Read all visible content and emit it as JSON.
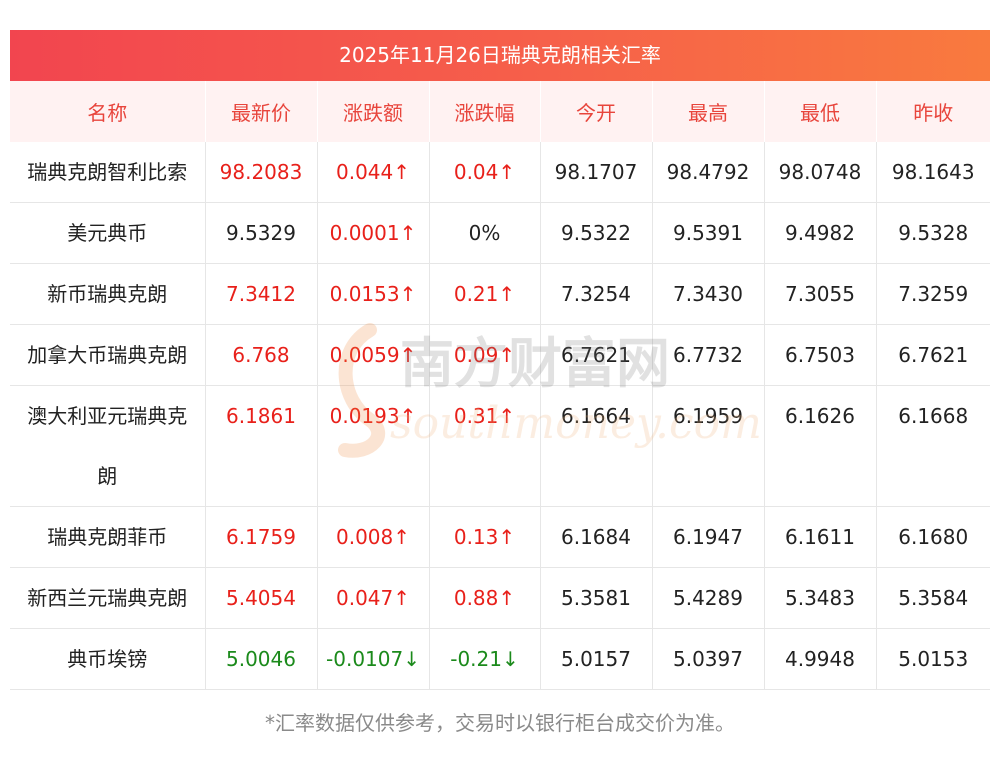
{
  "title": "2025年11月26日瑞典克朗相关汇率",
  "columns": [
    "名称",
    "最新价",
    "涨跌额",
    "涨跌幅",
    "今开",
    "最高",
    "最低",
    "昨收"
  ],
  "rows": [
    {
      "name": "瑞典克朗智利比索",
      "latest": "98.2083",
      "change": "0.044↑",
      "change_pct": "0.04↑",
      "open": "98.1707",
      "high": "98.4792",
      "low": "98.0748",
      "prev_close": "98.1643",
      "trend": "up"
    },
    {
      "name": "美元典币",
      "latest": "9.5329",
      "change": "0.0001↑",
      "change_pct": "0%",
      "open": "9.5322",
      "high": "9.5391",
      "low": "9.4982",
      "prev_close": "9.5328",
      "trend": "up-flat"
    },
    {
      "name": "新币瑞典克朗",
      "latest": "7.3412",
      "change": "0.0153↑",
      "change_pct": "0.21↑",
      "open": "7.3254",
      "high": "7.3430",
      "low": "7.3055",
      "prev_close": "7.3259",
      "trend": "up"
    },
    {
      "name": "加拿大币瑞典克朗",
      "latest": "6.768",
      "change": "0.0059↑",
      "change_pct": "0.09↑",
      "open": "6.7621",
      "high": "6.7732",
      "low": "6.7503",
      "prev_close": "6.7621",
      "trend": "up"
    },
    {
      "name_line1": "澳大利亚元瑞典克",
      "name_line2": "朗",
      "latest": "6.1861",
      "change": "0.0193↑",
      "change_pct": "0.31↑",
      "open": "6.1664",
      "high": "6.1959",
      "low": "6.1626",
      "prev_close": "6.1668",
      "trend": "up"
    },
    {
      "name": "瑞典克朗菲币",
      "latest": "6.1759",
      "change": "0.008↑",
      "change_pct": "0.13↑",
      "open": "6.1684",
      "high": "6.1947",
      "low": "6.1611",
      "prev_close": "6.1680",
      "trend": "up"
    },
    {
      "name": "新西兰元瑞典克朗",
      "latest": "5.4054",
      "change": "0.047↑",
      "change_pct": "0.88↑",
      "open": "5.3581",
      "high": "5.4289",
      "low": "5.3483",
      "prev_close": "5.3584",
      "trend": "up"
    },
    {
      "name": "典币埃镑",
      "latest": "5.0046",
      "change": "-0.0107↓",
      "change_pct": "-0.21↓",
      "open": "5.0157",
      "high": "5.0397",
      "low": "4.9948",
      "prev_close": "5.0153",
      "trend": "down"
    }
  ],
  "watermark": {
    "cn": "南方财富网",
    "en": "southmoney.com"
  },
  "footnote": "*汇率数据仅供参考，交易时以银行柜台成交价为准。",
  "colors": {
    "up": "#e8201a",
    "down": "#1b8a1b",
    "header_text": "#e8453c",
    "title_bg_start": "#f2454f",
    "title_bg_end": "#f97a3e"
  }
}
